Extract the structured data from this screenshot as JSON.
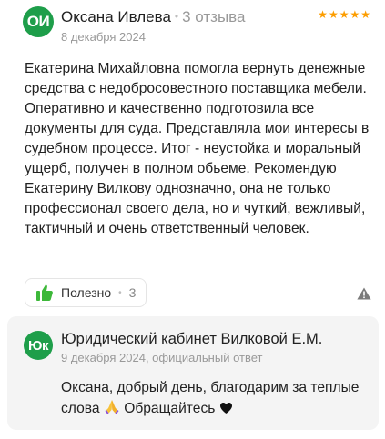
{
  "review": {
    "avatar_initials": "ОИ",
    "author": "Оксана Ивлева",
    "reviews_count": "3 отзыва",
    "date": "8 декабря 2024",
    "rating": 5,
    "text": "Екатерина Михайловна помогла вернуть денежные средства с недобросовестного поставщика мебели. Оперативно и качественно подготовила все документы для суда. Представляла мои интересы в судебном процессе. Итог - неустойка и моральный ущерб, получен в полном обьеме. Рекомендую Екатерину Вилкову однозначно, она не только профессионал своего дела, но и чуткий, вежливый, тактичный и очень ответственный человек."
  },
  "actions": {
    "like_label": "Полезно",
    "like_count": "3"
  },
  "reply": {
    "avatar_initials": "Юк",
    "author": "Юридический кабинет Вилковой Е.М.",
    "date": "9 декабря 2024, официальный ответ",
    "text_before_emoji": "Оксана, добрый день, благодарим за теплые слова ",
    "text_after_emoji": " Обращайтесь "
  },
  "colors": {
    "avatar": "#1e9e4a",
    "stars": "#fc9d00",
    "like_icon": "#3db83a"
  }
}
